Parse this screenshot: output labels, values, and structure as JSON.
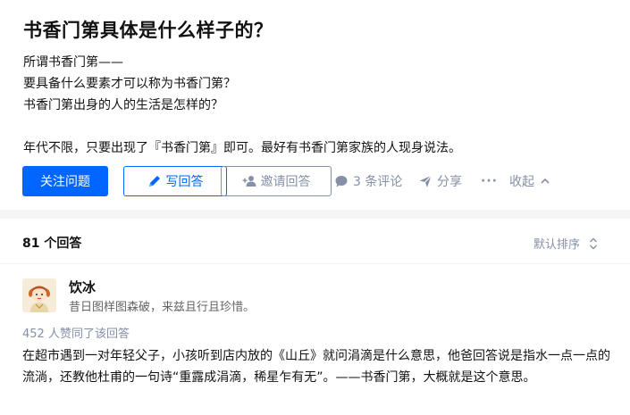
{
  "question": {
    "title": "书香门第具体是什么样子的？",
    "description": [
      "所谓书香门第——",
      "要具备什么要素才可以称为书香门第？",
      "书香门第出身的人的生活是怎样的？",
      "",
      "年代不限，只要出现了『书香门第』即可。最好有书香门第家族的人现身说法。"
    ]
  },
  "actions": {
    "follow_label": "关注问题",
    "answer_label": "写回答",
    "invite_label": "邀请回答",
    "comments_label": "3 条评论",
    "share_label": "分享",
    "more_label": "···",
    "collapse_label": "收起"
  },
  "answers": {
    "count_label": "81 个回答",
    "sort_label": "默认排序",
    "first": {
      "author": "饮冰",
      "bio": "昔日图样图森破，来兹且行且珍惜。",
      "votes": "452 人赞同了该回答",
      "content": "在超市遇到一对年轻父子，小孩听到店内放的《山丘》就问涓滴是什么意思，他爸回答说是指水一点一点的流淌，还教他杜甫的一句诗“重露成涓滴，稀星乍有无”。——书香门第，大概就是这个意思。"
    }
  },
  "colors": {
    "accent": "#0066ff",
    "muted": "#8590a6",
    "background": "#f6f6f6"
  },
  "icons": [
    "pen-icon",
    "invite-user-icon",
    "comment-icon",
    "share-icon",
    "chevron-up-icon",
    "sort-icon",
    "avatar"
  ]
}
